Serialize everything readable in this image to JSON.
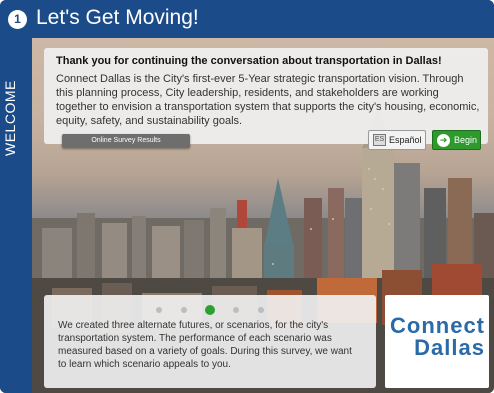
{
  "header": {
    "step_number": "1",
    "title": "Let's Get Moving!"
  },
  "side_tab": {
    "label": "WELCOME"
  },
  "intro": {
    "heading": "Thank you for continuing the conversation about transportation in Dallas!",
    "body": "Connect Dallas is the City's first-ever 5-Year strategic transportation vision. Through this planning process, City leadership, residents, and stakeholders are working together to envision a transportation system that supports the city's housing, economic, equity, safety, and sustainability goals."
  },
  "buttons": {
    "survey_results": "Online Survey Results",
    "espanol": "Español",
    "begin": "Begin"
  },
  "carousel": {
    "dot_count": 5,
    "active_index": 2,
    "text": "We created three alternate futures, or scenarios, for the city's transportation system. The performance of each scenario was measured based on a variety of goals. During this survey, we want to learn which scenario appeals to you."
  },
  "logo": {
    "line1": "Connect",
    "line2": "Dallas"
  },
  "colors": {
    "header_blue": "#1b4b89",
    "begin_green": "#2e9a2e",
    "logo_blue": "#2b6aa8",
    "active_dot": "#29a12f"
  },
  "icons": {
    "espanol": "globe-flag-icon",
    "begin": "arrow-right-circle-icon"
  }
}
